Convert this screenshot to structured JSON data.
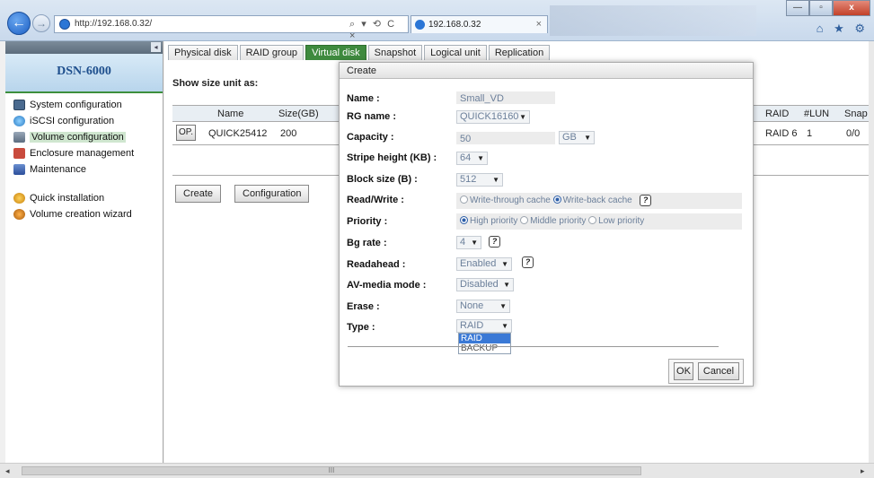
{
  "browser": {
    "url": "http://192.168.0.32/",
    "tab_title": "192.168.0.32",
    "tab_close": "×",
    "address_tools": "⌕ ▾ ⟲ C ×",
    "win_min": "—",
    "win_max": "▫",
    "win_close": "x",
    "toolbar_icons": "⌂ ★ ⚙"
  },
  "sidebar": {
    "collapse": "◂",
    "logo": "DSN-6000",
    "items": [
      {
        "label": "System configuration",
        "icon": "system-icon"
      },
      {
        "label": "iSCSI configuration",
        "icon": "iscsi-icon"
      },
      {
        "label": "Volume configuration",
        "icon": "volume-icon"
      },
      {
        "label": "Enclosure management",
        "icon": "enclosure-icon"
      },
      {
        "label": "Maintenance",
        "icon": "maintenance-icon"
      },
      {
        "label": "Quick installation",
        "icon": "quick-install-icon"
      },
      {
        "label": "Volume creation wizard",
        "icon": "wizard-icon"
      }
    ]
  },
  "content": {
    "tabs": [
      "Physical disk",
      "RAID group",
      "Virtual disk",
      "Snapshot",
      "Logical unit",
      "Replication"
    ],
    "active_tab": "Virtual disk",
    "show_size_label": "Show size unit as:",
    "table": {
      "headers": {
        "name": "Name",
        "size": "Size(GB)",
        "raid": "RAID",
        "lun": "#LUN",
        "snap": "Snap"
      },
      "row": {
        "op": "OP.",
        "name": "QUICK25412",
        "size": "200",
        "raid": "RAID 6",
        "lun": "1",
        "snap": "0/0"
      }
    },
    "create_button": "Create",
    "configuration_button": "Configuration"
  },
  "modal": {
    "title": "Create",
    "fields": {
      "name": {
        "label": "Name :",
        "value": "Small_VD"
      },
      "rg_name": {
        "label": "RG name :",
        "value": "QUICK16160"
      },
      "capacity": {
        "label": "Capacity :",
        "value": "50",
        "unit": "GB"
      },
      "stripe": {
        "label": "Stripe height (KB) :",
        "value": "64"
      },
      "block": {
        "label": "Block size (B) :",
        "value": "512"
      },
      "read_write": {
        "label": "Read/Write :",
        "opt1": "Write-through cache",
        "opt2": "Write-back cache"
      },
      "priority": {
        "label": "Priority :",
        "opt1": "High priority",
        "opt2": "Middle priority",
        "opt3": "Low priority"
      },
      "bg_rate": {
        "label": "Bg rate :",
        "value": "4"
      },
      "readahead": {
        "label": "Readahead :",
        "value": "Enabled"
      },
      "av_media": {
        "label": "AV-media mode :",
        "value": "Disabled"
      },
      "erase": {
        "label": "Erase :",
        "value": "None"
      },
      "type": {
        "label": "Type :",
        "value": "RAID",
        "options": [
          "RAID",
          "BACKUP"
        ]
      }
    },
    "help": "?",
    "ok": "OK",
    "cancel": "Cancel"
  },
  "scroll": {
    "thumb": "III",
    "left": "◂",
    "right": "▸"
  }
}
